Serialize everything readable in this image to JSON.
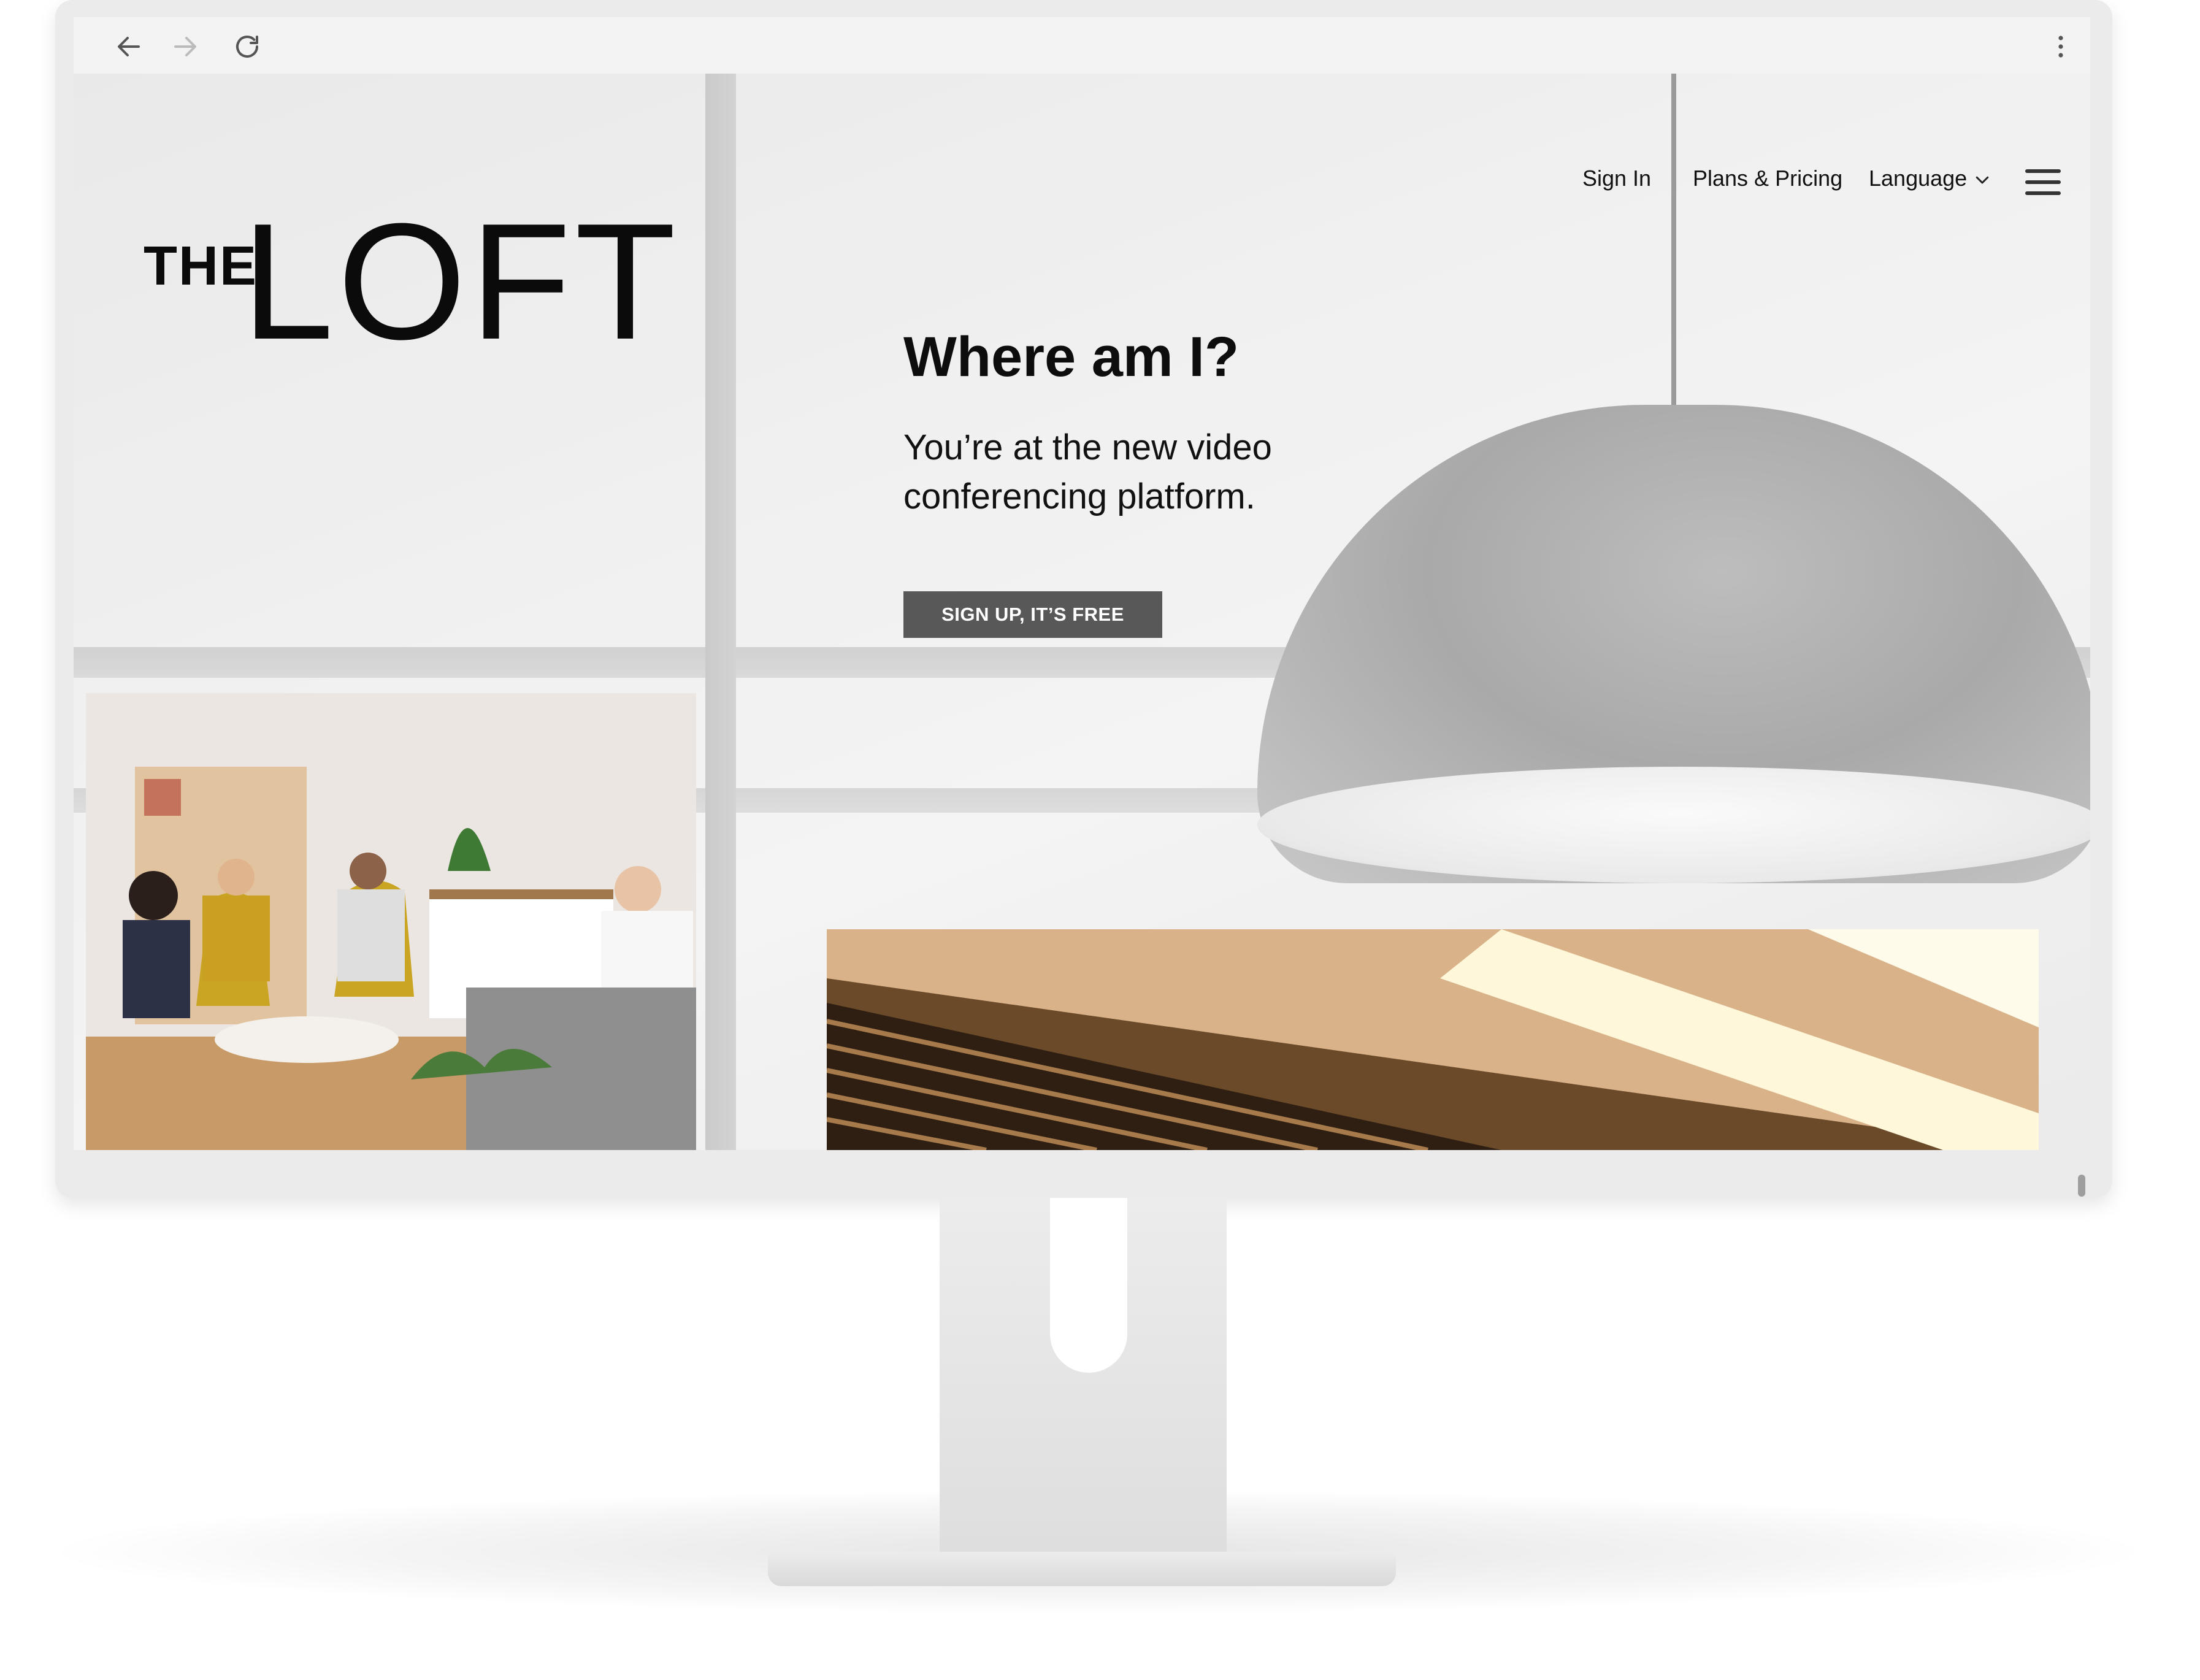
{
  "browser": {
    "back_icon": "arrow-left-icon",
    "forward_icon": "arrow-right-icon",
    "reload_icon": "reload-icon",
    "menu_icon": "kebab-menu-icon"
  },
  "nav": {
    "sign_in": "Sign In",
    "plans_pricing": "Plans & Pricing",
    "language": "Language",
    "language_icon": "chevron-down-icon",
    "menu_icon": "hamburger-menu-icon"
  },
  "logo": {
    "the": "THE",
    "loft": "LOFT"
  },
  "hero": {
    "title": "Where am I?",
    "subtitle": "You’re at the new video conferencing platform.",
    "cta": "SIGN UP, IT’S FREE"
  },
  "colors": {
    "cta_bg": "#585858",
    "text": "#111111",
    "monitor": "#ebebeb"
  }
}
